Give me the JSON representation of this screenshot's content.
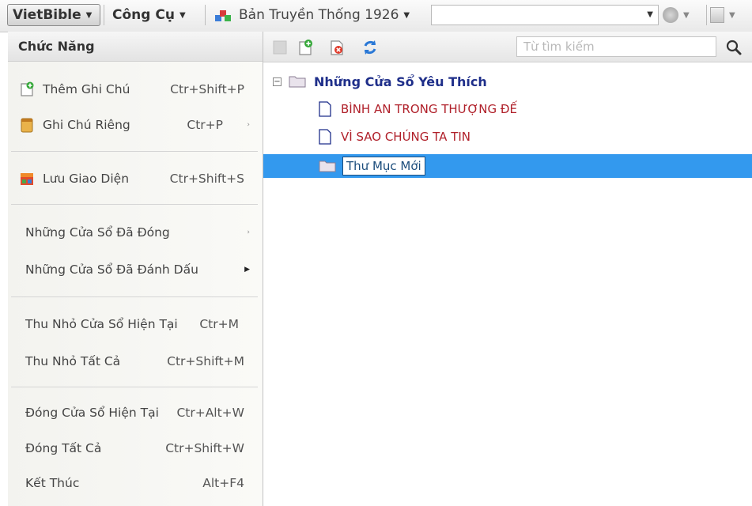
{
  "toolbar": {
    "app_menu": "VietBible",
    "tools_menu": "Công Cụ",
    "bible_version": "Bản Truyền Thống 1926",
    "version_select_value": ""
  },
  "menu": {
    "header": "Chức Năng",
    "items": [
      {
        "label": "Thêm Ghi Chú",
        "shortcut": "Ctr+Shift+P"
      },
      {
        "label": "Ghi Chú Riêng",
        "shortcut": "Ctr+P"
      },
      {
        "label": "Lưu Giao Diện",
        "shortcut": "Ctr+Shift+S"
      },
      {
        "label": "Những Cửa Sổ Đã Đóng",
        "shortcut": ""
      },
      {
        "label": "Những Cửa Sổ Đã Đánh Dấu",
        "shortcut": ""
      },
      {
        "label": "Thu Nhỏ Cửa Sổ Hiện Tại",
        "shortcut": "Ctr+M"
      },
      {
        "label": "Thu Nhỏ Tất Cả",
        "shortcut": "Ctr+Shift+M"
      },
      {
        "label": "Đóng Cửa Sổ Hiện Tại",
        "shortcut": "Ctr+Alt+W"
      },
      {
        "label": "Đóng Tất Cả",
        "shortcut": "Ctr+Shift+W"
      },
      {
        "label": "Kết Thúc",
        "shortcut": "Alt+F4"
      }
    ]
  },
  "content": {
    "search_placeholder": "Từ tìm kiếm",
    "tree": {
      "root": "Những Cửa Sổ Yêu Thích",
      "children": [
        "BÌNH AN TRONG THƯỢNG ĐẾ",
        "VÌ SAO CHÚNG TA TIN"
      ],
      "new_folder": "Thư Mục Mới"
    }
  },
  "colors": {
    "selection": "#3399ee",
    "root_text": "#1f2f8a",
    "item_text": "#b0202a"
  },
  "icons": [
    "add-note-icon",
    "note-icon",
    "save-layout-icon",
    "bookmark-icon",
    "new-note-icon",
    "delete-note-icon",
    "refresh-icon",
    "search-icon",
    "folder-icon",
    "document-icon"
  ]
}
